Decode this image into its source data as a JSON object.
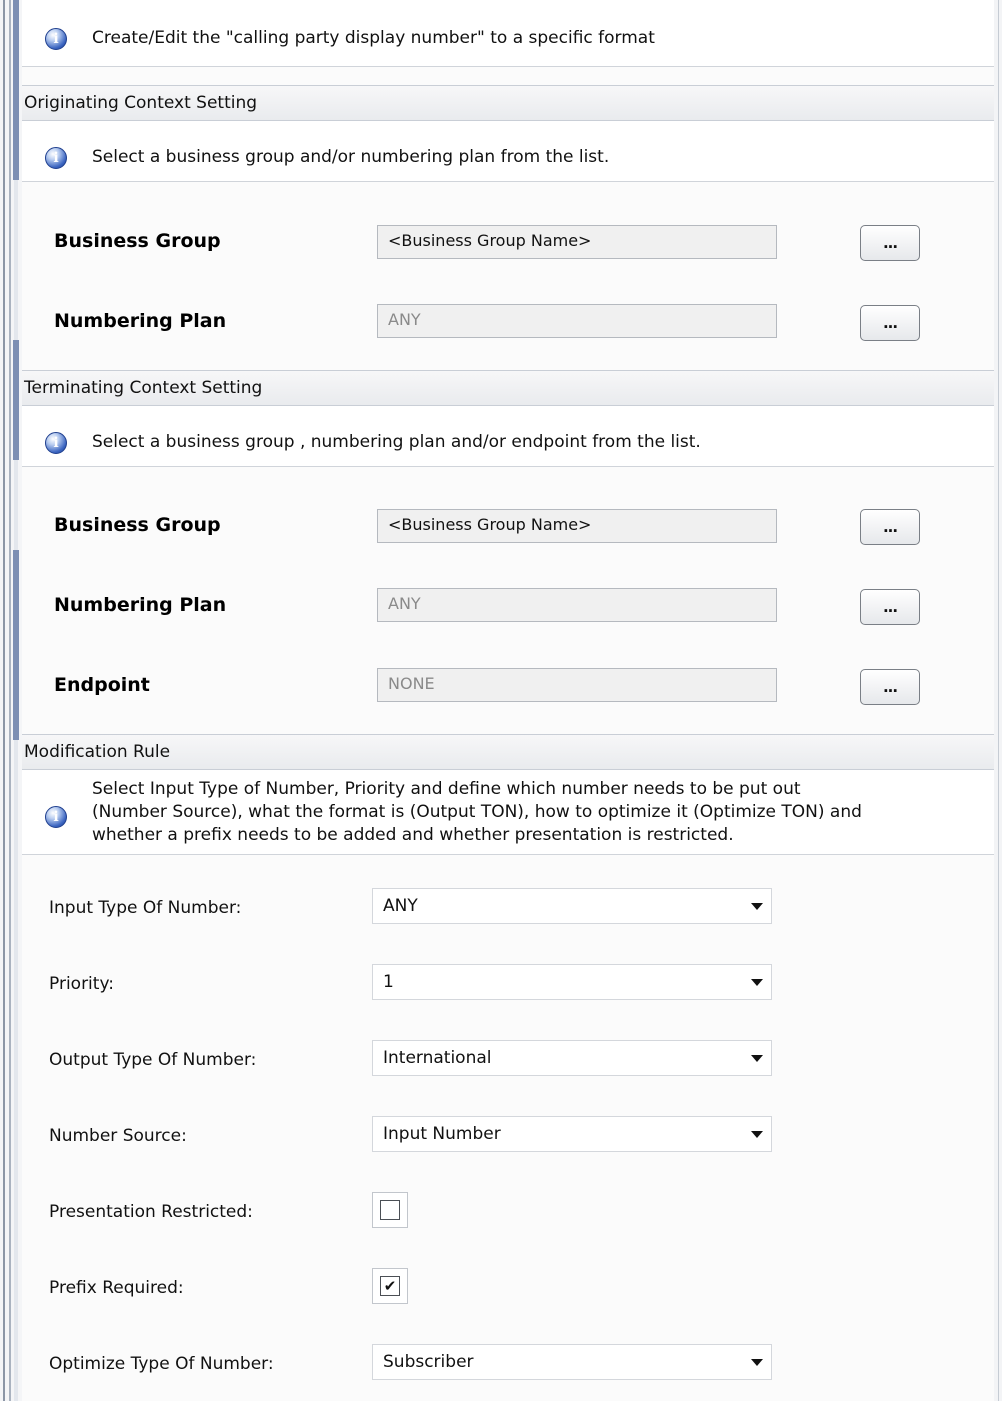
{
  "intro": {
    "text": "Create/Edit the \"calling party display number\" to a specific format"
  },
  "originating": {
    "header": "Originating Context Setting",
    "info": "Select a business group and/or numbering plan from the list.",
    "business_group": {
      "label": "Business Group",
      "value": "<Business Group Name>",
      "button": "..."
    },
    "numbering_plan": {
      "label": "Numbering Plan",
      "value": "ANY",
      "button": "..."
    }
  },
  "terminating": {
    "header": "Terminating Context Setting",
    "info": "Select a business group , numbering plan and/or endpoint from the list.",
    "business_group": {
      "label": "Business Group",
      "value": "<Business Group Name>",
      "button": "..."
    },
    "numbering_plan": {
      "label": "Numbering Plan",
      "value": "ANY",
      "button": "..."
    },
    "endpoint": {
      "label": "Endpoint",
      "value": "NONE",
      "button": "..."
    }
  },
  "modification": {
    "header": "Modification Rule",
    "info_lines": [
      "Select Input Type of Number, Priority and define which number needs to be put out",
      "(Number Source), what the format is (Output TON), how to optimize it (Optimize TON) and",
      "whether a prefix needs to be added and whether presentation is restricted."
    ],
    "input_ton": {
      "label": "Input Type Of Number:",
      "value": "ANY"
    },
    "priority": {
      "label": "Priority:",
      "value": "1"
    },
    "output_ton": {
      "label": "Output Type Of Number:",
      "value": "International"
    },
    "number_source": {
      "label": "Number Source:",
      "value": "Input Number"
    },
    "presentation_restricted": {
      "label": "Presentation Restricted:",
      "checked": false,
      "mark": ""
    },
    "prefix_required": {
      "label": "Prefix Required:",
      "checked": true,
      "mark": "✔"
    },
    "optimize_ton": {
      "label": "Optimize Type Of Number:",
      "value": "Subscriber"
    }
  }
}
